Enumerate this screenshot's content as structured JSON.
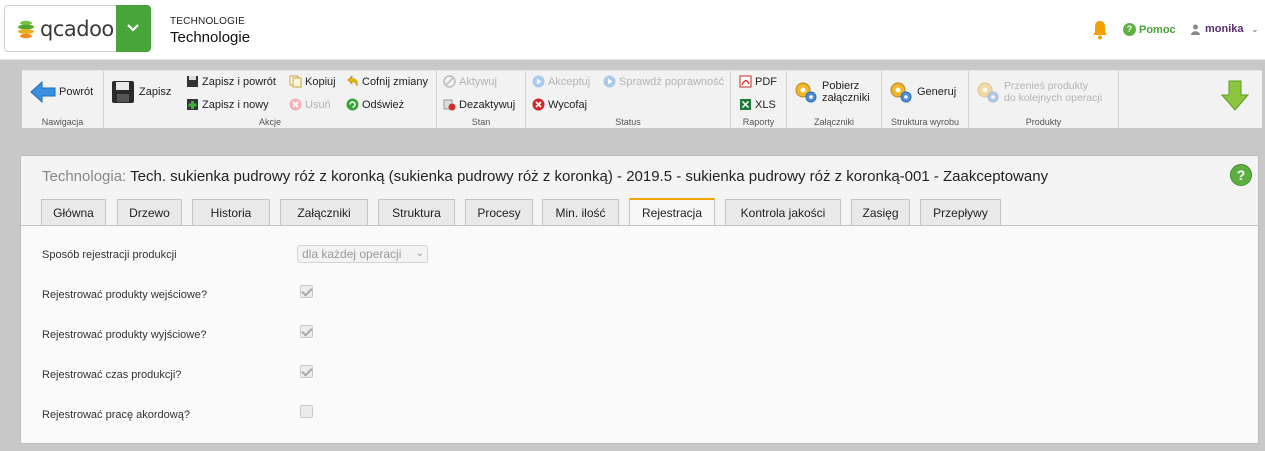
{
  "header": {
    "logo_text": "qcadoo",
    "app_kind": "TECHNOLOGIE",
    "app_name": "Technologie",
    "help_label": "Pomoc",
    "user_name": "monika"
  },
  "ribbon": {
    "groups": {
      "nawigacja": "Nawigacja",
      "akcje": "Akcje",
      "stan": "Stan",
      "status": "Status",
      "raporty": "Raporty",
      "zalaczniki": "Załączniki",
      "struktura": "Struktura wyrobu",
      "produkty": "Produkty"
    },
    "buttons": {
      "powrot": "Powrót",
      "zapisz": "Zapisz",
      "zapisz_i_powrot": "Zapisz i powrót",
      "zapisz_i_nowy": "Zapisz i nowy",
      "kopiuj": "Kopiuj",
      "usun": "Usuń",
      "cofnij_zmiany": "Cofnij zmiany",
      "odswiez": "Odśwież",
      "aktywuj": "Aktywuj",
      "dezaktywuj": "Dezaktywuj",
      "akceptuj": "Akceptuj",
      "sprawdz_poprawnosc": "Sprawdź poprawność",
      "wycofaj": "Wycofaj",
      "pdf": "PDF",
      "xls": "XLS",
      "pobierz_1": "Pobierz",
      "pobierz_2": "załączniki",
      "generuj": "Generuj",
      "przenies_1": "Przenieś produkty",
      "przenies_2": "do kolejnych operacji"
    }
  },
  "panel": {
    "title_prefix": "Technologia:",
    "title": "Tech. sukienka pudrowy róż z koronką (sukienka pudrowy róż z koronką) - 2019.5 - sukienka pudrowy róż z koronką-001 - Zaakceptowany",
    "tabs": [
      "Główna",
      "Drzewo",
      "Historia",
      "Załączniki",
      "Struktura",
      "Procesy",
      "Min. ilość",
      "Rejestracja",
      "Kontrola jakości",
      "Zasięg",
      "Przepływy"
    ],
    "active_tab": "Rejestracja"
  },
  "form": {
    "sposob_label": "Sposób rejestracji produkcji",
    "sposob_value": "dla każdej operacji",
    "fields": [
      {
        "label": "Rejestrować produkty wejściowe?",
        "checked": true
      },
      {
        "label": "Rejestrować produkty wyjściowe?",
        "checked": true
      },
      {
        "label": "Rejestrować czas produkcji?",
        "checked": true
      },
      {
        "label": "Rejestrować pracę akordową?",
        "checked": false
      }
    ]
  },
  "colors": {
    "brand_green": "#47a53a",
    "active_tab_accent": "#f0a500",
    "user_purple": "#5a2d74"
  }
}
